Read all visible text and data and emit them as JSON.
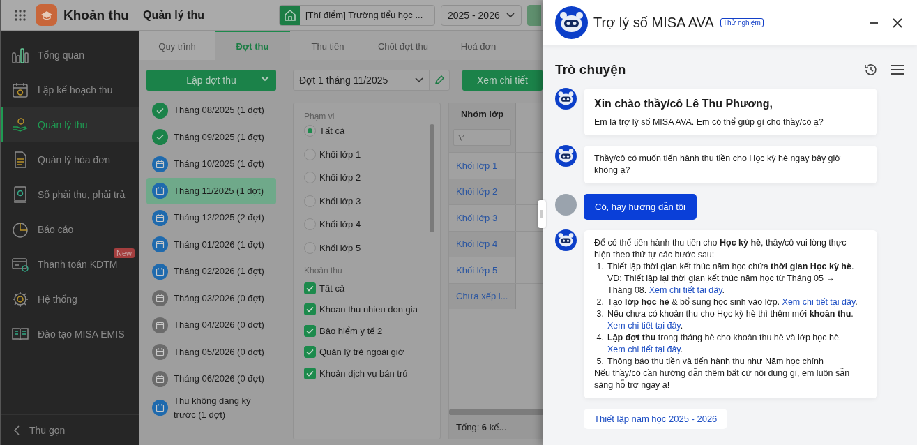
{
  "app_header": {
    "app_name": "Khoản thu",
    "page_title": "Quản lý thu",
    "school": "[Thí điểm] Trường tiểu học ...",
    "year": "2025 - 2026"
  },
  "sidebar": {
    "items": [
      {
        "label": "Tổng quan",
        "selected": false
      },
      {
        "label": "Lập kế hoạch thu",
        "selected": false
      },
      {
        "label": "Quản lý thu",
        "selected": true
      },
      {
        "label": "Quản lý hóa đơn",
        "selected": false
      },
      {
        "label": "Sổ phải thu, phải trả",
        "selected": false
      },
      {
        "label": "Báo cáo",
        "selected": false
      },
      {
        "label": "Thanh toán KDTM",
        "selected": false,
        "badge": "New"
      },
      {
        "label": "Hệ thống",
        "selected": false
      },
      {
        "label": "Đào tạo MISA EMIS",
        "selected": false
      }
    ],
    "collapse": "Thu gọn"
  },
  "tabs": [
    {
      "label": "Quy trình",
      "selected": false
    },
    {
      "label": "Đợt thu",
      "selected": true
    },
    {
      "label": "Thu tiền",
      "selected": false
    },
    {
      "label": "Chốt đợt thu",
      "selected": false
    },
    {
      "label": "Hoá đơn",
      "selected": false
    }
  ],
  "batches": {
    "create_button": "Lập đợt thu",
    "items": [
      {
        "label": "Tháng 08/2025 (1 đợt)",
        "kind": "done",
        "selected": false
      },
      {
        "label": "Tháng 09/2025 (1 đợt)",
        "kind": "done",
        "selected": false
      },
      {
        "label": "Tháng 10/2025 (1 đợt)",
        "kind": "open",
        "selected": false
      },
      {
        "label": "Tháng 11/2025 (1 đợt)",
        "kind": "open",
        "selected": true
      },
      {
        "label": "Tháng 12/2025 (2 đợt)",
        "kind": "open",
        "selected": false
      },
      {
        "label": "Tháng 01/2026 (1 đợt)",
        "kind": "open",
        "selected": false
      },
      {
        "label": "Tháng 02/2026 (1 đợt)",
        "kind": "open",
        "selected": false
      },
      {
        "label": "Tháng 03/2026 (0 đợt)",
        "kind": "empty",
        "selected": false
      },
      {
        "label": "Tháng 04/2026 (0 đợt)",
        "kind": "empty",
        "selected": false
      },
      {
        "label": "Tháng 05/2026 (0 đợt)",
        "kind": "empty",
        "selected": false
      },
      {
        "label": "Tháng 06/2026 (0 đợt)",
        "kind": "empty",
        "selected": false
      },
      {
        "label": "Thu không đăng ký trước (1 đợt)",
        "kind": "open",
        "selected": false
      }
    ]
  },
  "batch_select": "Đợt 1 tháng 11/2025",
  "detail_button": "Xem chi tiết",
  "filters": {
    "scope": {
      "title": "Phạm vi",
      "options": [
        {
          "label": "Tất cả",
          "selected": true
        },
        {
          "label": "Khối lớp 1",
          "selected": false
        },
        {
          "label": "Khối lớp 2",
          "selected": false
        },
        {
          "label": "Khối lớp 3",
          "selected": false
        },
        {
          "label": "Khối lớp 4",
          "selected": false
        },
        {
          "label": "Khối lớp 5",
          "selected": false
        }
      ]
    },
    "fees": {
      "title": "Khoản thu",
      "options": [
        {
          "label": "Tất cả",
          "checked": true
        },
        {
          "label": "Khoan thu nhieu don gia",
          "checked": true
        },
        {
          "label": "Bảo hiểm y tế 2",
          "checked": true
        },
        {
          "label": "Quản lý trẻ ngoài giờ",
          "checked": true
        },
        {
          "label": "Khoản dịch vụ bán trú",
          "checked": true
        }
      ]
    }
  },
  "table": {
    "columns": [
      "Nhóm lớp"
    ],
    "rows": [
      "Khối lớp 1",
      "Khối lớp 2",
      "Khối lớp 3",
      "Khối lớp 4",
      "Khối lớp 5",
      "Chưa xếp l..."
    ],
    "footer": "Tổng: **6** kế..."
  },
  "assistant": {
    "title": "Trợ lý số MISA AVA",
    "badge": "Thử nghiệm",
    "section_title": "Trò chuyện",
    "messages": [
      {
        "kind": "greeting",
        "title": "Xin chào thầy/cô Lê Thu Phương,",
        "text": "Em là trợ lý số MISA AVA. Em có thể giúp gì cho thầy/cô ạ?"
      },
      {
        "kind": "bot",
        "text": "Thầy/cô có muốn tiến hành thu tiền cho Học kỳ hè ngay bây giờ không ạ?"
      },
      {
        "kind": "user",
        "text": "Có, hãy hướng dẫn tôi"
      },
      {
        "kind": "steps",
        "intro": "Để có thể tiến hành thu tiền cho **Học kỳ hè**, thầy/cô vui lòng thực hiện theo thứ tự các bước sau:",
        "steps": [
          {
            "number": "1.",
            "text": "Thiết lập thời gian kết thúc năm học chứa **thời gian Học kỳ hè**. VD: Thiết lập lại thời gian kết thúc năm học từ Tháng 05 → Tháng 08.",
            "link": "Xem chi tiết tại đây",
            "after": "."
          },
          {
            "number": "2.",
            "text": "Tạo **lớp học hè** & bổ sung học sinh vào lớp.",
            "link": "Xem chi tiết tại đây",
            "after": "."
          },
          {
            "number": "3.",
            "text": "Nếu chưa có khoản thu cho Học kỳ hè thì thêm mới **khoản thu**.",
            "link": "Xem chi tiết tại đây",
            "after": "."
          },
          {
            "number": "4.",
            "text": "**Lập đợt thu** trong tháng hè cho khoản thu hè và lớp học hè.",
            "link": "Xem chi tiết tại đây",
            "after": "."
          },
          {
            "number": "5.",
            "text": "Thông báo thu tiền và tiến hành thu như Năm học chính"
          }
        ],
        "outro": "Nếu thầy/cô cần hướng dẫn thêm bất cứ nội dung gì, em luôn sẵn sàng hỗ trợ ngay ạ!"
      }
    ],
    "suggestion": "Thiết lập năm học 2025 - 2026"
  }
}
